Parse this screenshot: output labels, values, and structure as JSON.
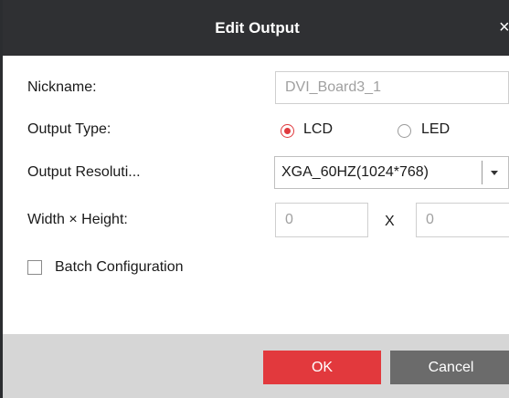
{
  "dialog": {
    "title": "Edit Output",
    "close_symbol": "×"
  },
  "fields": {
    "nickname_label": "Nickname:",
    "nickname_value": "DVI_Board3_1",
    "output_type_label": "Output Type:",
    "output_type_options": [
      "LCD",
      "LED"
    ],
    "output_type_selected": "LCD",
    "resolution_label": "Output Resoluti...",
    "resolution_value": "XGA_60HZ(1024*768)",
    "size_label": "Width × Height:",
    "width_value": "0",
    "separator": "X",
    "height_value": "0",
    "batch_label": "Batch Configuration",
    "batch_checked": false
  },
  "buttons": {
    "ok": "OK",
    "cancel": "Cancel"
  },
  "colors": {
    "title_bar": "#2f3033",
    "accent": "#e2393d",
    "cancel": "#6b6b6b",
    "footer": "#d6d6d6"
  },
  "icons": [
    "close-icon",
    "radio-icon",
    "chevron-down-icon",
    "checkbox-icon"
  ]
}
